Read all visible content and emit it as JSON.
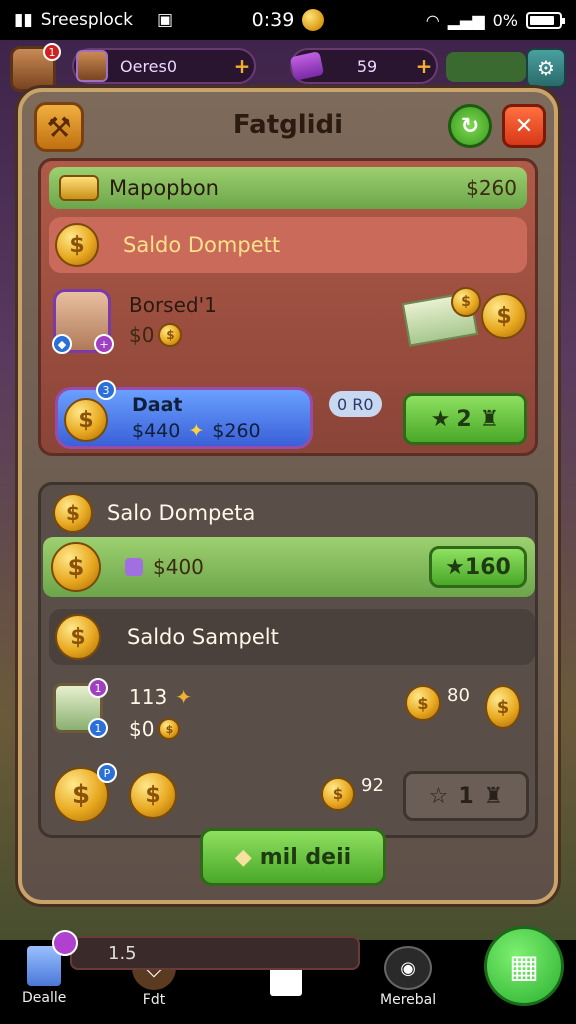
{
  "status_bar": {
    "carrier": "Sreesplock",
    "time": "0:39",
    "battery": "0%"
  },
  "topbar": {
    "player_name": "Oeres0",
    "gem_count": "59"
  },
  "panel": {
    "title": "Fatglidi",
    "header_row": {
      "label": "Mapopbon",
      "value": "$260"
    },
    "wallet_row_1": {
      "label": "Saldo Dompett"
    },
    "character": {
      "name": "Borsed'1",
      "sub_value": "$0"
    },
    "deal_card": {
      "title": "Daat",
      "price_old": "$440",
      "price_new": "$260",
      "badge": "3"
    },
    "counter_badge": "0 R0",
    "deal_button": "2",
    "section2_title": "Salo Dompeta",
    "green_row": {
      "value": "$400",
      "button": "160"
    },
    "wallet_row_2": {
      "label": "Saldo Sampelt"
    },
    "cash_item": {
      "count": "113",
      "sub_value": "$0",
      "right_value": "80"
    },
    "coins_row": {
      "value": "92",
      "button": "1"
    },
    "claim_button": "mil deii"
  },
  "bottom_bar": {
    "progress_text": "1.5",
    "nav": [
      "Dealle",
      "Fdt",
      "",
      "Merebal"
    ]
  },
  "colors": {
    "accent_gold": "#e8a820",
    "accent_green": "#4aa828",
    "panel_border": "#c9a46a"
  }
}
